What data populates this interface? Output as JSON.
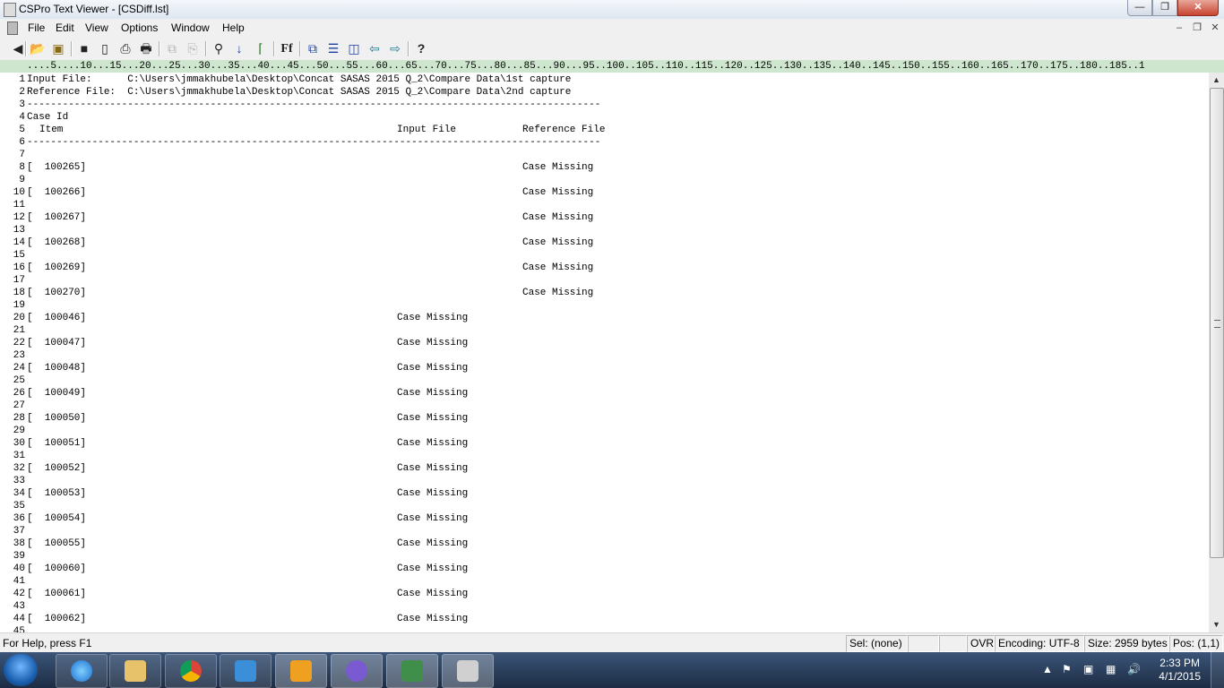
{
  "window": {
    "title": "CSPro Text Viewer - [CSDiff.lst]",
    "buttons": {
      "minimize": "—",
      "maximize": "❐",
      "close": "✕"
    }
  },
  "menu": {
    "items": [
      "File",
      "Edit",
      "View",
      "Options",
      "Window",
      "Help"
    ],
    "mdi_buttons": {
      "minimize": "–",
      "restore": "❐",
      "close": "✕"
    }
  },
  "toolbar": {
    "icons": [
      "back-icon",
      "open-icon",
      "open-folder-icon",
      "save-icon",
      "new-icon",
      "print-preview-icon",
      "print-icon",
      "copy-icon",
      "paste-icon",
      "find-icon",
      "find-next-icon",
      "ruler-icon",
      "font-icon",
      "cascade-icon",
      "tile-horizontal-icon",
      "tile-vertical-icon",
      "previous-window-icon",
      "next-window-icon",
      "help-icon"
    ],
    "font_label": "Ff"
  },
  "ruler": "....5....10...15...20...25...30...35...40...45...50...55...60...65...70...75...80...85...90...95..100..105..110..115..120..125..130..135..140..145..150..155..160..165..170..175..180..185..1",
  "document": {
    "lines": [
      {
        "n": "1",
        "text": "Input File:      C:\\Users\\jmmakhubela\\Desktop\\Concat SASAS 2015 Q_2\\Compare Data\\1st capture"
      },
      {
        "n": "2",
        "text": "Reference File:  C:\\Users\\jmmakhubela\\Desktop\\Concat SASAS 2015 Q_2\\Compare Data\\2nd capture"
      },
      {
        "n": "3",
        "text": "-------------------------------------------------------------------------------------------------"
      },
      {
        "n": "4",
        "text": "Case Id"
      },
      {
        "n": "5",
        "item": "Item",
        "col_input": "Input File",
        "col_ref": "Reference File"
      },
      {
        "n": "6",
        "text": "-------------------------------------------------------------------------------------------------"
      },
      {
        "n": "7"
      },
      {
        "n": "8",
        "case": "[  100265]",
        "ref": "Case Missing"
      },
      {
        "n": "9"
      },
      {
        "n": "10",
        "case": "[  100266]",
        "ref": "Case Missing"
      },
      {
        "n": "11"
      },
      {
        "n": "12",
        "case": "[  100267]",
        "ref": "Case Missing"
      },
      {
        "n": "13"
      },
      {
        "n": "14",
        "case": "[  100268]",
        "ref": "Case Missing"
      },
      {
        "n": "15"
      },
      {
        "n": "16",
        "case": "[  100269]",
        "ref": "Case Missing"
      },
      {
        "n": "17"
      },
      {
        "n": "18",
        "case": "[  100270]",
        "ref": "Case Missing"
      },
      {
        "n": "19"
      },
      {
        "n": "20",
        "case": "[  100046]",
        "input": "Case Missing"
      },
      {
        "n": "21"
      },
      {
        "n": "22",
        "case": "[  100047]",
        "input": "Case Missing"
      },
      {
        "n": "23"
      },
      {
        "n": "24",
        "case": "[  100048]",
        "input": "Case Missing"
      },
      {
        "n": "25"
      },
      {
        "n": "26",
        "case": "[  100049]",
        "input": "Case Missing"
      },
      {
        "n": "27"
      },
      {
        "n": "28",
        "case": "[  100050]",
        "input": "Case Missing"
      },
      {
        "n": "29"
      },
      {
        "n": "30",
        "case": "[  100051]",
        "input": "Case Missing"
      },
      {
        "n": "31"
      },
      {
        "n": "32",
        "case": "[  100052]",
        "input": "Case Missing"
      },
      {
        "n": "33"
      },
      {
        "n": "34",
        "case": "[  100053]",
        "input": "Case Missing"
      },
      {
        "n": "35"
      },
      {
        "n": "36",
        "case": "[  100054]",
        "input": "Case Missing"
      },
      {
        "n": "37"
      },
      {
        "n": "38",
        "case": "[  100055]",
        "input": "Case Missing"
      },
      {
        "n": "39"
      },
      {
        "n": "40",
        "case": "[  100060]",
        "input": "Case Missing"
      },
      {
        "n": "41"
      },
      {
        "n": "42",
        "case": "[  100061]",
        "input": "Case Missing"
      },
      {
        "n": "43"
      },
      {
        "n": "44",
        "case": "[  100062]",
        "input": "Case Missing"
      },
      {
        "n": "45"
      }
    ]
  },
  "statusbar": {
    "help": "For Help, press F1",
    "sel": "Sel: (none)",
    "blank1": "",
    "blank2": "",
    "ovr": "OVR",
    "encoding": "Encoding: UTF-8",
    "size": "Size: 2959 bytes",
    "pos": "Pos: (1,1)"
  },
  "taskbar": {
    "apps": [
      "internet-explorer",
      "file-explorer",
      "chrome",
      "media-player",
      "outlook",
      "cspro",
      "data-entry",
      "text-viewer"
    ],
    "time": "2:33 PM",
    "date": "4/1/2015"
  }
}
